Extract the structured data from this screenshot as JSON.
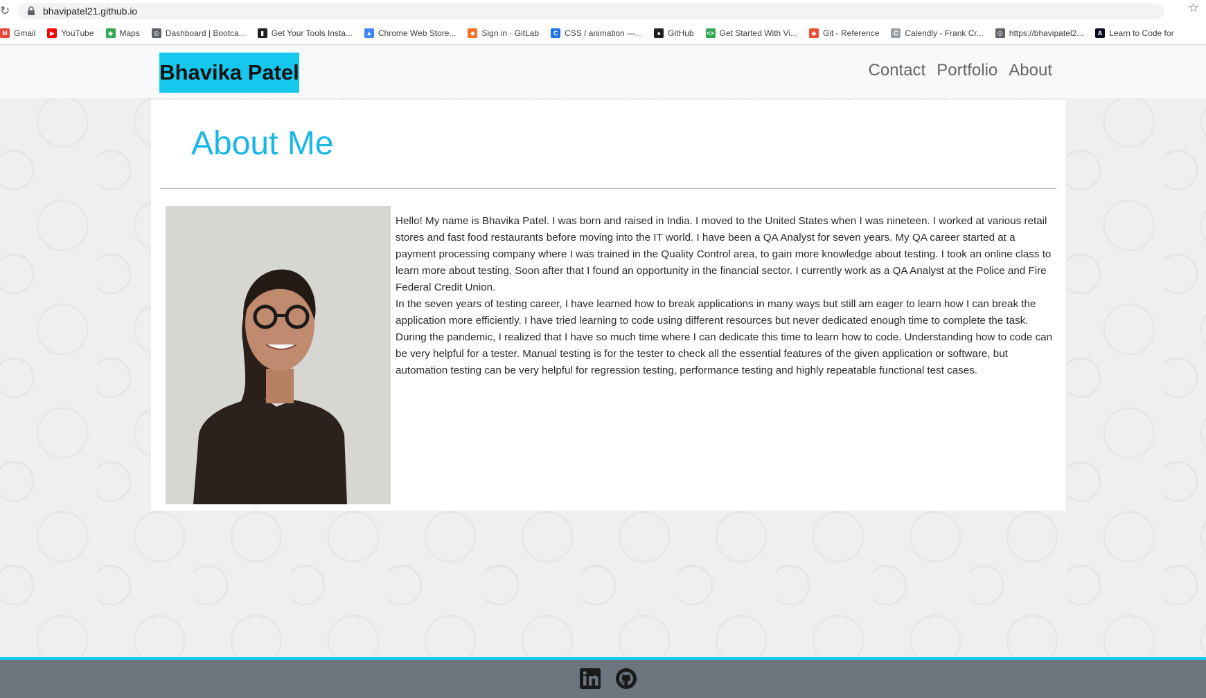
{
  "browser": {
    "url": "bhavipatel21.github.io",
    "bookmarks": [
      {
        "label": "Gmail",
        "icon": "gmail-icon",
        "color": "#ea4335",
        "glyph": "M"
      },
      {
        "label": "YouTube",
        "icon": "youtube-icon",
        "color": "#ff0000",
        "glyph": "▶"
      },
      {
        "label": "Maps",
        "icon": "maps-icon",
        "color": "#34a853",
        "glyph": "◆"
      },
      {
        "label": "Dashboard | Bootca...",
        "icon": "globe-icon",
        "color": "#5f6368",
        "glyph": "◎"
      },
      {
        "label": "Get Your Tools Insta...",
        "icon": "book-icon",
        "color": "#202124",
        "glyph": "▮"
      },
      {
        "label": "Chrome Web Store...",
        "icon": "chrome-store-icon",
        "color": "#4285f4",
        "glyph": "▲"
      },
      {
        "label": "Sign in · GitLab",
        "icon": "gitlab-icon",
        "color": "#fc6d26",
        "glyph": "◆"
      },
      {
        "label": "CSS / animation —...",
        "icon": "css-icon",
        "color": "#1a73e8",
        "glyph": "C"
      },
      {
        "label": "GitHub",
        "icon": "github-icon",
        "color": "#202124",
        "glyph": "●"
      },
      {
        "label": "Get Started With Vi...",
        "icon": "code-icon",
        "color": "#34a853",
        "glyph": "<>"
      },
      {
        "label": "Git - Reference",
        "icon": "git-icon",
        "color": "#f05032",
        "glyph": "◆"
      },
      {
        "label": "Calendly - Frank Cr...",
        "icon": "calendly-icon",
        "color": "#9aa0a6",
        "glyph": "C"
      },
      {
        "label": "https://bhavipatel2...",
        "icon": "globe-icon",
        "color": "#5f6368",
        "glyph": "◎"
      },
      {
        "label": "Learn to Code for",
        "icon": "freecodecamp-icon",
        "color": "#0a0a23",
        "glyph": "A"
      }
    ]
  },
  "navbar": {
    "brand": "Bhavika Patel",
    "links": [
      "Contact",
      "Portfolio",
      "About"
    ],
    "brand_color": "#17c8ee"
  },
  "about": {
    "title": "About Me",
    "paragraphs": [
      "Hello! My name is Bhavika Patel. I was born and raised in India. I moved to the United States when I was nineteen. I worked at various retail stores and fast food restaurants before moving into the IT world. I have been a QA Analyst for seven years. My QA career started at a payment processing company where I was trained in the Quality Control area, to gain more knowledge about testing. I took an online class to learn more about testing. Soon after that I found an opportunity in the financial sector. I currently work as a QA Analyst at the Police and Fire Federal Credit Union.",
      "In the seven years of testing career, I have learned how to break applications in many ways but still am eager to learn how I can break the application more efficiently. I have tried learning to code using different resources but never dedicated enough time to complete the task. During the pandemic, I realized that I have so much time where I can dedicate this time to learn how to code. Understanding how to code can be very helpful for a tester. Manual testing is for the tester to check all the essential features of the given application or software, but automation testing can be very helpful for regression testing, performance testing and highly repeatable functional test cases."
    ]
  },
  "footer": {
    "icons": [
      "linkedin-icon",
      "github-icon"
    ],
    "bg_color": "#6c757d",
    "accent_color": "#17c8ee"
  }
}
